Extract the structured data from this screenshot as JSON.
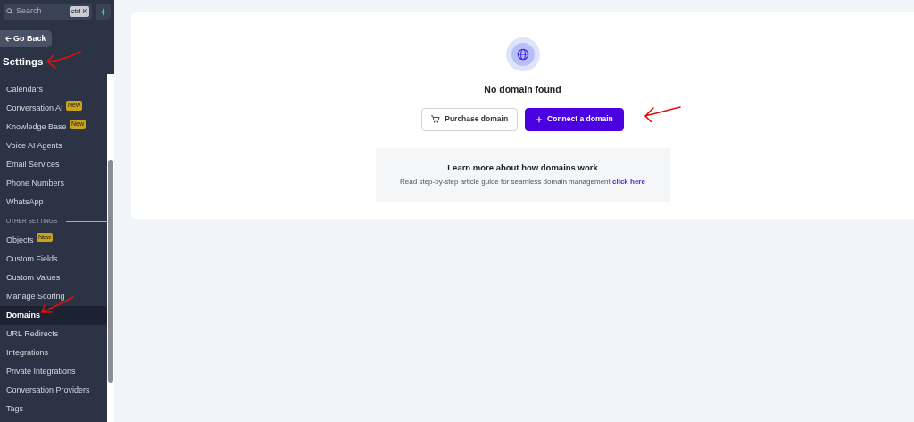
{
  "sidebar": {
    "search": {
      "placeholder": "Search",
      "shortcut": "ctrl K"
    },
    "back_button": "Go Back",
    "title": "Settings",
    "items": [
      {
        "kind": "item",
        "label": "Calendars",
        "selected": false
      },
      {
        "kind": "item",
        "label": "Conversation AI",
        "badge": "New",
        "selected": false
      },
      {
        "kind": "item",
        "label": "Knowledge Base",
        "badge": "New",
        "selected": false
      },
      {
        "kind": "item",
        "label": "Voice AI Agents",
        "selected": false
      },
      {
        "kind": "item",
        "label": "Email Services",
        "selected": false
      },
      {
        "kind": "item",
        "label": "Phone Numbers",
        "selected": false
      },
      {
        "kind": "item",
        "label": "WhatsApp",
        "selected": false
      },
      {
        "kind": "section",
        "label": "OTHER SETTINGS"
      },
      {
        "kind": "item",
        "label": "Objects",
        "badge": "New",
        "selected": false
      },
      {
        "kind": "item",
        "label": "Custom Fields",
        "selected": false
      },
      {
        "kind": "item",
        "label": "Custom Values",
        "selected": false
      },
      {
        "kind": "item",
        "label": "Manage Scoring",
        "selected": false
      },
      {
        "kind": "item",
        "label": "Domains",
        "selected": true
      },
      {
        "kind": "item",
        "label": "URL Redirects",
        "selected": false
      },
      {
        "kind": "item",
        "label": "Integrations",
        "selected": false
      },
      {
        "kind": "item",
        "label": "Private Integrations",
        "selected": false
      },
      {
        "kind": "item",
        "label": "Conversation Providers",
        "selected": false
      },
      {
        "kind": "item",
        "label": "Tags",
        "selected": false
      }
    ]
  },
  "main": {
    "empty_title": "No domain found",
    "buttons": [
      {
        "kind": "outline",
        "label": "Purchase domain"
      },
      {
        "kind": "primary",
        "label": "Connect a domain"
      }
    ],
    "info": {
      "title": "Learn more about how domains work",
      "text": "Read step-by-step article guide for seamless domain management",
      "link": "click here"
    }
  }
}
